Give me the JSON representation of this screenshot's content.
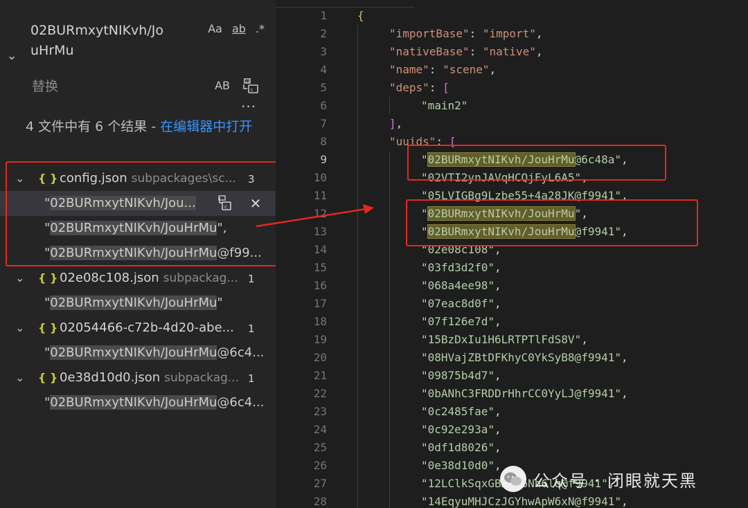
{
  "search": {
    "query": "02BURmxytNIKvh/JouHrMu",
    "options": {
      "match_case": "Aa",
      "whole_word": "ab",
      "regex": ".*"
    },
    "replace_placeholder": "替换",
    "preserve_case": "AB",
    "more": "···",
    "summary_prefix": "4 文件中有 6 个结果 - ",
    "summary_link": "在编辑器中打开"
  },
  "results": [
    {
      "file": "config.json",
      "path": "subpackages\\sc...",
      "count": "3",
      "matches": [
        {
          "pre": "\"",
          "hit": "02BURmxytNIKvh/Jou...",
          "post": "",
          "selected": true
        },
        {
          "pre": "\"",
          "hit": "02BURmxytNIKvh/JouHrMu",
          "post": "\",",
          "selected": false
        },
        {
          "pre": "\"",
          "hit": "02BURmxytNIKvh/JouHrMu",
          "post": "@f99...",
          "selected": false
        }
      ]
    },
    {
      "file": "02e08c108.json",
      "path": "subpackag...",
      "count": "1",
      "matches": [
        {
          "pre": "\"",
          "hit": "02BURmxytNIKvh/JouHrMu",
          "post": "\"",
          "selected": false
        }
      ]
    },
    {
      "file": "02054466-c72b-4d20-abe...",
      "path": "",
      "count": "1",
      "matches": [
        {
          "pre": "\"",
          "hit": "02BURmxytNIKvh/JouHrMu",
          "post": "@6c4...",
          "selected": false
        }
      ]
    },
    {
      "file": "0e38d10d0.json",
      "path": "subpackag...",
      "count": "1",
      "matches": [
        {
          "pre": "\"",
          "hit": "02BURmxytNIKvh/JouHrMu",
          "post": "@6c4...",
          "selected": false
        }
      ]
    }
  ],
  "match_actions": {
    "replace_icon": "replace-icon",
    "dismiss_icon": "close-icon"
  },
  "editor": {
    "active_line": 9,
    "lines": [
      {
        "n": "1",
        "indent": 0,
        "parts": [
          [
            "brace",
            "{"
          ]
        ]
      },
      {
        "n": "2",
        "indent": 1,
        "parts": [
          [
            "key",
            "\"importBase\""
          ],
          [
            "punc",
            ": "
          ],
          [
            "str",
            "\"import\""
          ],
          [
            "punc",
            ","
          ]
        ]
      },
      {
        "n": "3",
        "indent": 1,
        "parts": [
          [
            "key",
            "\"nativeBase\""
          ],
          [
            "punc",
            ": "
          ],
          [
            "str",
            "\"native\""
          ],
          [
            "punc",
            ","
          ]
        ]
      },
      {
        "n": "4",
        "indent": 1,
        "parts": [
          [
            "key",
            "\"name\""
          ],
          [
            "punc",
            ": "
          ],
          [
            "str",
            "\"scene\""
          ],
          [
            "punc",
            ","
          ]
        ]
      },
      {
        "n": "5",
        "indent": 1,
        "parts": [
          [
            "key",
            "\"deps\""
          ],
          [
            "punc",
            ": "
          ],
          [
            "bracket",
            "["
          ]
        ]
      },
      {
        "n": "6",
        "indent": 2,
        "parts": [
          [
            "uuid",
            "\"main2\""
          ]
        ]
      },
      {
        "n": "7",
        "indent": 1,
        "parts": [
          [
            "bracket",
            "]"
          ],
          [
            "punc",
            ","
          ]
        ]
      },
      {
        "n": "8",
        "indent": 1,
        "parts": [
          [
            "key",
            "\"uuids\""
          ],
          [
            "punc",
            ": "
          ],
          [
            "bracket",
            "["
          ]
        ]
      },
      {
        "n": "9",
        "indent": 2,
        "parts": [
          [
            "uuid",
            "\""
          ],
          [
            "hl",
            "02BURmxytNIKvh/JouHrMu"
          ],
          [
            "uuid",
            "@6c48a\""
          ],
          [
            "punc",
            ","
          ]
        ]
      },
      {
        "n": "10",
        "indent": 2,
        "parts": [
          [
            "uuid",
            "\"02VTI2ynJAVqHCQjFyL6A5\""
          ],
          [
            "punc",
            ","
          ]
        ]
      },
      {
        "n": "11",
        "indent": 2,
        "parts": [
          [
            "uuid",
            "\"05LVIGBg9Lzbe55+4a28JK@f9941\""
          ],
          [
            "punc",
            ","
          ]
        ]
      },
      {
        "n": "12",
        "indent": 2,
        "parts": [
          [
            "uuid",
            "\""
          ],
          [
            "hl",
            "02BURmxytNIKvh/JouHrMu"
          ],
          [
            "uuid",
            "\""
          ],
          [
            "punc",
            ","
          ]
        ]
      },
      {
        "n": "13",
        "indent": 2,
        "parts": [
          [
            "uuid",
            "\""
          ],
          [
            "hl",
            "02BURmxytNIKvh/JouHrMu"
          ],
          [
            "uuid",
            "@f9941\""
          ],
          [
            "punc",
            ","
          ]
        ]
      },
      {
        "n": "14",
        "indent": 2,
        "parts": [
          [
            "uuid",
            "\"02e08c108\""
          ],
          [
            "punc",
            ","
          ]
        ]
      },
      {
        "n": "15",
        "indent": 2,
        "parts": [
          [
            "uuid",
            "\"03fd3d2f0\""
          ],
          [
            "punc",
            ","
          ]
        ]
      },
      {
        "n": "16",
        "indent": 2,
        "parts": [
          [
            "uuid",
            "\"068a4ee98\""
          ],
          [
            "punc",
            ","
          ]
        ]
      },
      {
        "n": "17",
        "indent": 2,
        "parts": [
          [
            "uuid",
            "\"07eac8d0f\""
          ],
          [
            "punc",
            ","
          ]
        ]
      },
      {
        "n": "18",
        "indent": 2,
        "parts": [
          [
            "uuid",
            "\"07f126e7d\""
          ],
          [
            "punc",
            ","
          ]
        ]
      },
      {
        "n": "19",
        "indent": 2,
        "parts": [
          [
            "uuid",
            "\"15BzDxIu1H6LRTPTlFdS8V\""
          ],
          [
            "punc",
            ","
          ]
        ]
      },
      {
        "n": "20",
        "indent": 2,
        "parts": [
          [
            "uuid",
            "\"08HVajZBtDFKhyC0YkSyB8@f9941\""
          ],
          [
            "punc",
            ","
          ]
        ]
      },
      {
        "n": "21",
        "indent": 2,
        "parts": [
          [
            "uuid",
            "\"09875b4d7\""
          ],
          [
            "punc",
            ","
          ]
        ]
      },
      {
        "n": "22",
        "indent": 2,
        "parts": [
          [
            "uuid",
            "\"0bANhC3FRDDrHhrCC0YyLJ@f9941\""
          ],
          [
            "punc",
            ","
          ]
        ]
      },
      {
        "n": "23",
        "indent": 2,
        "parts": [
          [
            "uuid",
            "\"0c2485fae\""
          ],
          [
            "punc",
            ","
          ]
        ]
      },
      {
        "n": "24",
        "indent": 2,
        "parts": [
          [
            "uuid",
            "\"0c92e293a\""
          ],
          [
            "punc",
            ","
          ]
        ]
      },
      {
        "n": "25",
        "indent": 2,
        "parts": [
          [
            "uuid",
            "\"0df1d8026\""
          ],
          [
            "punc",
            ","
          ]
        ]
      },
      {
        "n": "26",
        "indent": 2,
        "parts": [
          [
            "uuid",
            "\"0e38d10d0\""
          ],
          [
            "punc",
            ","
          ]
        ]
      },
      {
        "n": "27",
        "indent": 2,
        "parts": [
          [
            "uuid",
            "\"12LClkSqxG"
          ],
          [
            "uuid",
            "BAhv6Nh6lq@f9941\""
          ],
          [
            "punc",
            ","
          ]
        ]
      },
      {
        "n": "28",
        "indent": 2,
        "parts": [
          [
            "uuid",
            "\"14EqyuMHJCzJGYhwApW6xN@f9941\""
          ],
          [
            "punc",
            ","
          ]
        ]
      }
    ]
  },
  "watermark": {
    "text": "公众号 · 闭眼就天黑"
  },
  "colors": {
    "annotation": "#e8271f",
    "link": "#3794ff",
    "find_highlight": "#625f2b"
  }
}
